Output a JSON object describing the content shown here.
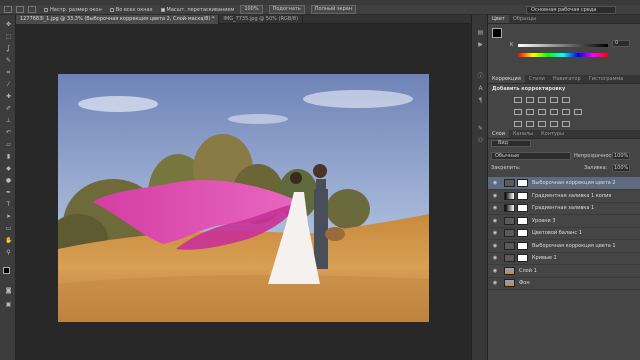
{
  "options_bar": {
    "resize_windows": "Настр. размер окон",
    "all_windows": "Во всех окнах",
    "scrubby_zoom": "Масшт. перетаскиванием",
    "zoom_value": "100%",
    "fit_screen": "Подогнать",
    "full_screen": "Полный экран",
    "workspace": "Основная рабочая среда"
  },
  "document_tabs": [
    {
      "label": "1277683l_1.jpg @ 33,3% (Выборочная коррекция цвета 2, Слой-маска/8) *"
    },
    {
      "label": "IMG_7735.jpg @ 50% (RGB/8)"
    }
  ],
  "color_panel": {
    "tabs": [
      "Цвет",
      "Образцы"
    ],
    "k_label": "K",
    "k_value": "0"
  },
  "adjustments_panel": {
    "tabs": [
      "Коррекция",
      "Стили",
      "Навигатор",
      "Гистограмма"
    ],
    "title": "Добавить корректировку"
  },
  "layers_panel": {
    "tabs": [
      "Слои",
      "Каналы",
      "Контуры"
    ],
    "kind": "Вид",
    "blend_mode": "Обычные",
    "opacity_label": "Непрозрачность:",
    "opacity_value": "100%",
    "lock_label": "Закрепить:",
    "fill_label": "Заливка:",
    "fill_value": "100%",
    "layers": [
      {
        "name": "Выборочная коррекция цвета 2",
        "selected": true,
        "type": "adj"
      },
      {
        "name": "Градиентная заливка 1 копия",
        "selected": false,
        "type": "grad"
      },
      {
        "name": "Градиентная заливка 1",
        "selected": false,
        "type": "grad"
      },
      {
        "name": "Уровни 3",
        "selected": false,
        "type": "adj"
      },
      {
        "name": "Цветовой баланс 1",
        "selected": false,
        "type": "adj"
      },
      {
        "name": "Выборочная коррекция цвета 1",
        "selected": false,
        "type": "adj"
      },
      {
        "name": "Кривые 1",
        "selected": false,
        "type": "adj"
      },
      {
        "name": "Слой 1",
        "selected": false,
        "type": "photo"
      },
      {
        "name": "Фон",
        "selected": false,
        "type": "photo"
      }
    ]
  }
}
